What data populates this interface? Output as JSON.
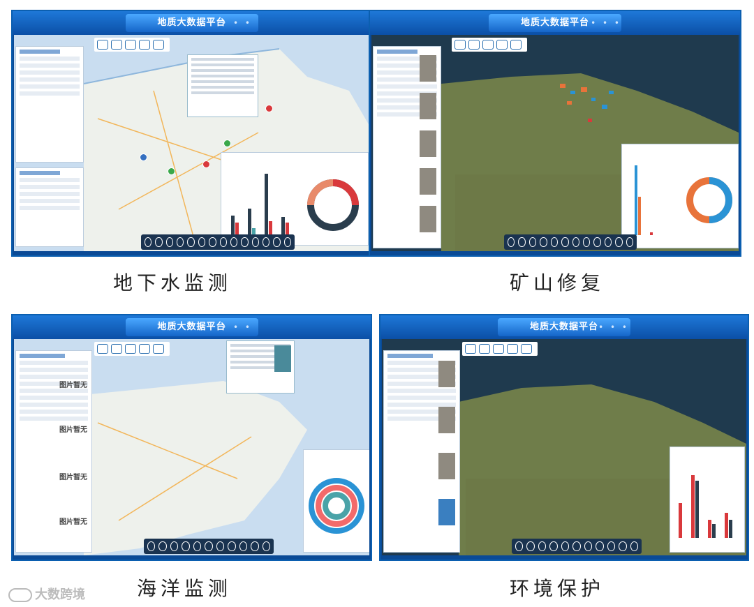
{
  "platform_title": "地质大数据平台",
  "header_dots": "• • •",
  "panels": [
    {
      "caption": "地下水监测"
    },
    {
      "caption": "矿山修复"
    },
    {
      "caption": "海洋监测"
    },
    {
      "caption": "环境保护"
    }
  ],
  "picture_placeholder": "图片暂无",
  "watermark": "大数跨境",
  "colors": {
    "header": "#0b4fa6",
    "tab": "#1565c8",
    "marker_red": "#d9393c",
    "marker_green": "#3aa84a",
    "bar_dark": "#2a3d4d",
    "bar_teal": "#4aa3a8",
    "mine_orange": "#e8733a",
    "mine_blue": "#2a93d5"
  }
}
